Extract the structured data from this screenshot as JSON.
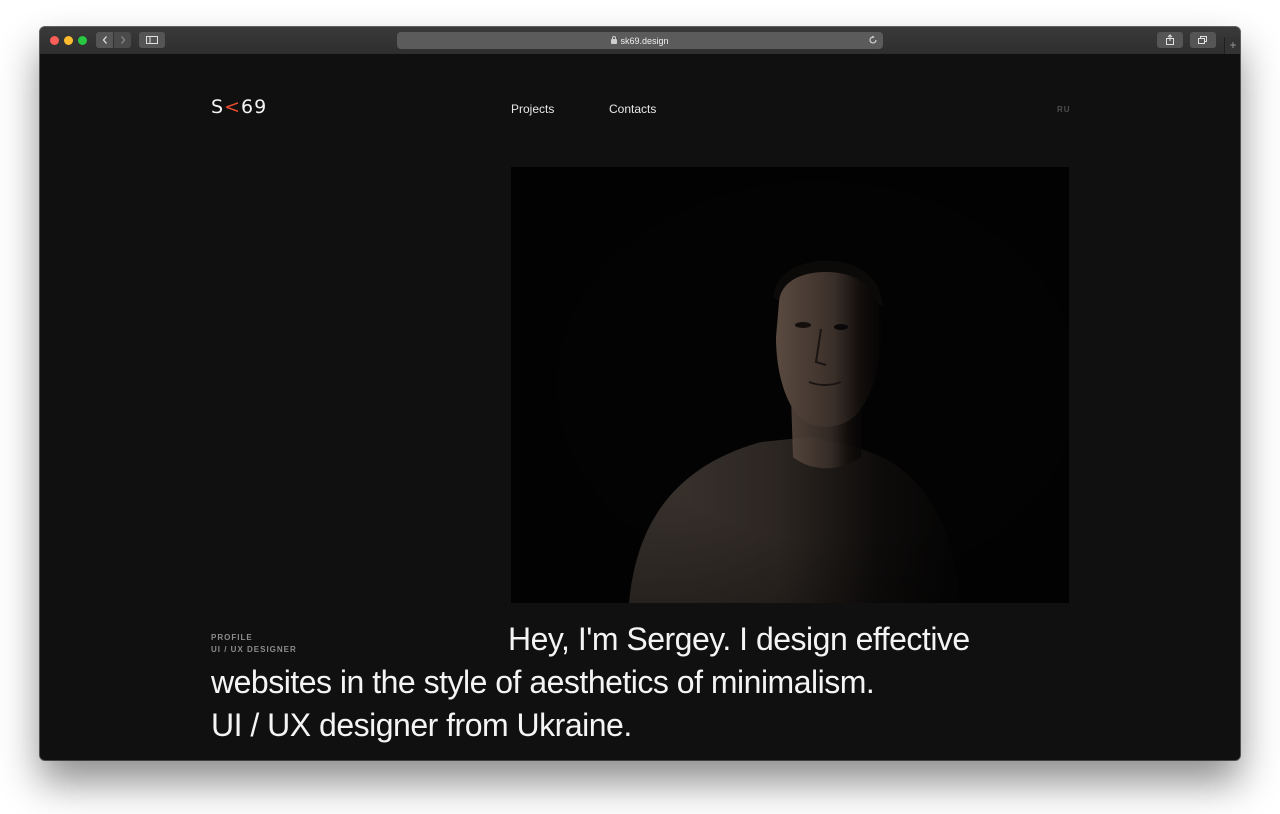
{
  "browser": {
    "url": "sk69.design",
    "new_tab_label": "+"
  },
  "site": {
    "logo_left": "S",
    "logo_mark": "<",
    "logo_right": "69",
    "nav": {
      "projects": "Projects",
      "contacts": "Contacts"
    },
    "language": "RU"
  },
  "hero": {
    "profile_label": "PROFILE",
    "role_label": "UI / UX DESIGNER",
    "line1": "Hey, I'm Sergey. I design effective",
    "line2": "websites in the style of aesthetics of minimalism.",
    "line3": "UI / UX designer from Ukraine."
  },
  "colors": {
    "background": "#111010",
    "accent": "#e84a2f",
    "text": "#f4f4f4"
  }
}
